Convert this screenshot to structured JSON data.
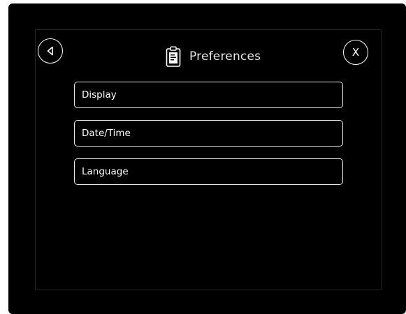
{
  "header": {
    "title": "Preferences",
    "icon": "clipboard-icon"
  },
  "nav": {
    "back_icon": "back-triangle-icon",
    "close_label": "X"
  },
  "menu": {
    "items": [
      {
        "label": "Display"
      },
      {
        "label": "Date/Time"
      },
      {
        "label": "Language"
      }
    ]
  },
  "colors": {
    "background": "#000000",
    "foreground": "#ffffff",
    "frame_border": "#232323"
  }
}
